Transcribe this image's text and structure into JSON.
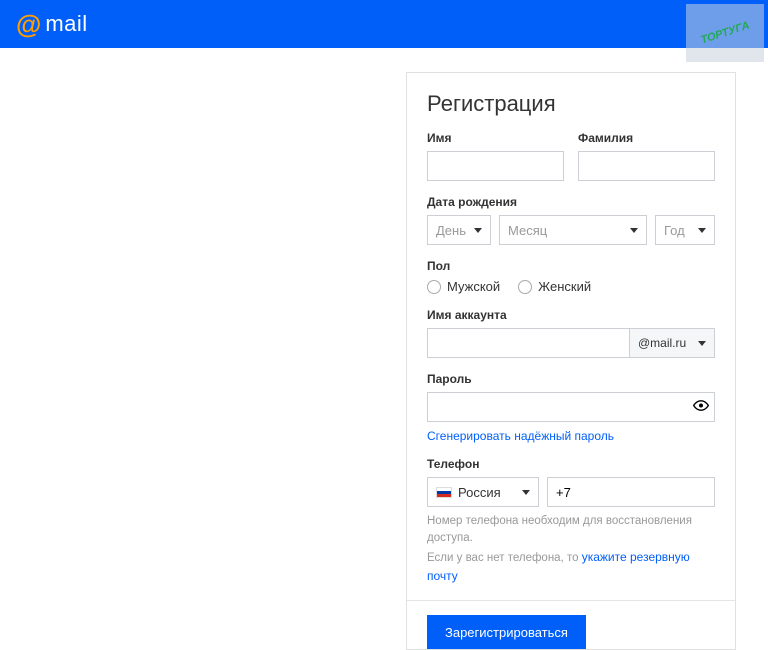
{
  "header": {
    "brand": "mail"
  },
  "watermark": "ТОРТУГА",
  "form": {
    "title": "Регистрация",
    "firstName": {
      "label": "Имя"
    },
    "lastName": {
      "label": "Фамилия"
    },
    "dob": {
      "label": "Дата рождения",
      "day": "День",
      "month": "Месяц",
      "year": "Год"
    },
    "gender": {
      "label": "Пол",
      "male": "Мужской",
      "female": "Женский"
    },
    "account": {
      "label": "Имя аккаунта",
      "domain": "@mail.ru"
    },
    "password": {
      "label": "Пароль",
      "generate": "Сгенерировать надёжный пароль"
    },
    "phone": {
      "label": "Телефон",
      "country": "Россия",
      "code": "+7",
      "hint1": "Номер телефона необходим для восстановления доступа.",
      "hint2a": "Если у вас нет телефона, то ",
      "hint2b": "укажите резервную почту"
    },
    "submit": "Зарегистрироваться"
  }
}
